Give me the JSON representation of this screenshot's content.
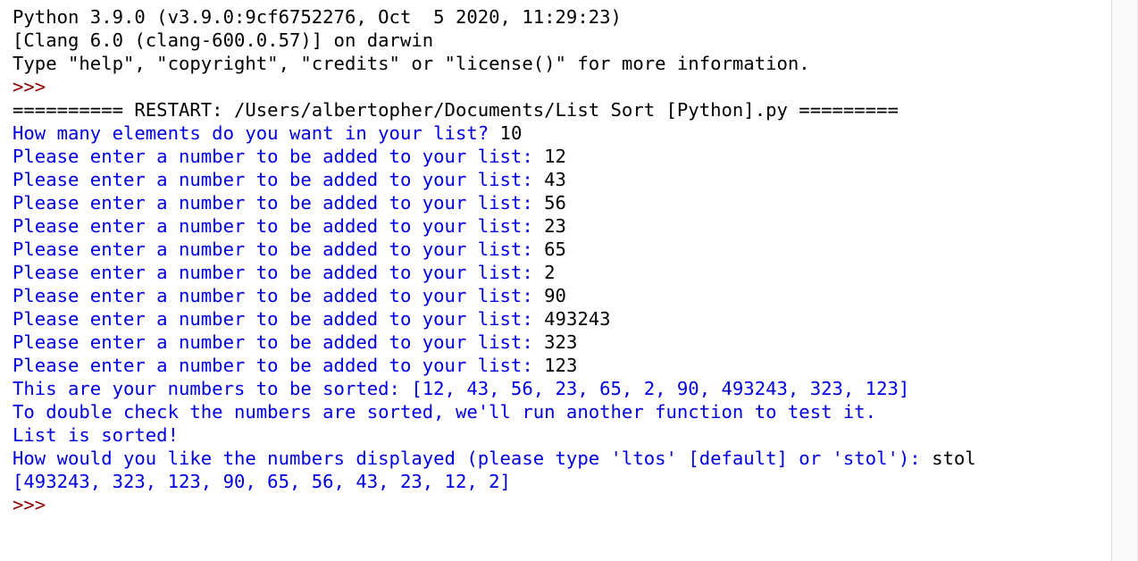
{
  "colors": {
    "stdout": "#000000",
    "program_output": "#0000e6",
    "prompt": "#8b0000",
    "background": "#ffffff"
  },
  "lines": [
    [
      {
        "text": "Python 3.9.0 (v3.9.0:9cf6752276, Oct  5 2020, 11:29:23)",
        "role": "stdout"
      }
    ],
    [
      {
        "text": "[Clang 6.0 (clang-600.0.57)] on darwin",
        "role": "stdout"
      }
    ],
    [
      {
        "text": "Type \"help\", \"copyright\", \"credits\" or \"license()\" for more information.",
        "role": "stdout"
      }
    ],
    [
      {
        "text": ">>>",
        "role": "prompt"
      }
    ],
    [
      {
        "text": "========== RESTART: /Users/albertopher/Documents/List Sort [Python].py =========",
        "role": "stdout"
      }
    ],
    [
      {
        "text": "How many elements do you want in your list? ",
        "role": "blue"
      },
      {
        "text": "10",
        "role": "stdout"
      }
    ],
    [
      {
        "text": "Please enter a number to be added to your list: ",
        "role": "blue"
      },
      {
        "text": "12",
        "role": "stdout"
      }
    ],
    [
      {
        "text": "Please enter a number to be added to your list: ",
        "role": "blue"
      },
      {
        "text": "43",
        "role": "stdout"
      }
    ],
    [
      {
        "text": "Please enter a number to be added to your list: ",
        "role": "blue"
      },
      {
        "text": "56",
        "role": "stdout"
      }
    ],
    [
      {
        "text": "Please enter a number to be added to your list: ",
        "role": "blue"
      },
      {
        "text": "23",
        "role": "stdout"
      }
    ],
    [
      {
        "text": "Please enter a number to be added to your list: ",
        "role": "blue"
      },
      {
        "text": "65",
        "role": "stdout"
      }
    ],
    [
      {
        "text": "Please enter a number to be added to your list: ",
        "role": "blue"
      },
      {
        "text": "2",
        "role": "stdout"
      }
    ],
    [
      {
        "text": "Please enter a number to be added to your list: ",
        "role": "blue"
      },
      {
        "text": "90",
        "role": "stdout"
      }
    ],
    [
      {
        "text": "Please enter a number to be added to your list: ",
        "role": "blue"
      },
      {
        "text": "493243",
        "role": "stdout"
      }
    ],
    [
      {
        "text": "Please enter a number to be added to your list: ",
        "role": "blue"
      },
      {
        "text": "323",
        "role": "stdout"
      }
    ],
    [
      {
        "text": "Please enter a number to be added to your list: ",
        "role": "blue"
      },
      {
        "text": "123",
        "role": "stdout"
      }
    ],
    [
      {
        "text": "This are your numbers to be sorted: [12, 43, 56, 23, 65, 2, 90, 493243, 323, 123]",
        "role": "blue"
      }
    ],
    [
      {
        "text": "To double check the numbers are sorted, we'll run another function to test it.",
        "role": "blue"
      }
    ],
    [
      {
        "text": "List is sorted!",
        "role": "blue"
      }
    ],
    [
      {
        "text": "How would you like the numbers displayed (please type 'ltos' [default] or 'stol'): ",
        "role": "blue"
      },
      {
        "text": "stol",
        "role": "stdout"
      }
    ],
    [
      {
        "text": "[493243, 323, 123, 90, 65, 56, 43, 23, 12, 2]",
        "role": "blue"
      }
    ],
    [
      {
        "text": ">>>",
        "role": "prompt"
      }
    ]
  ]
}
